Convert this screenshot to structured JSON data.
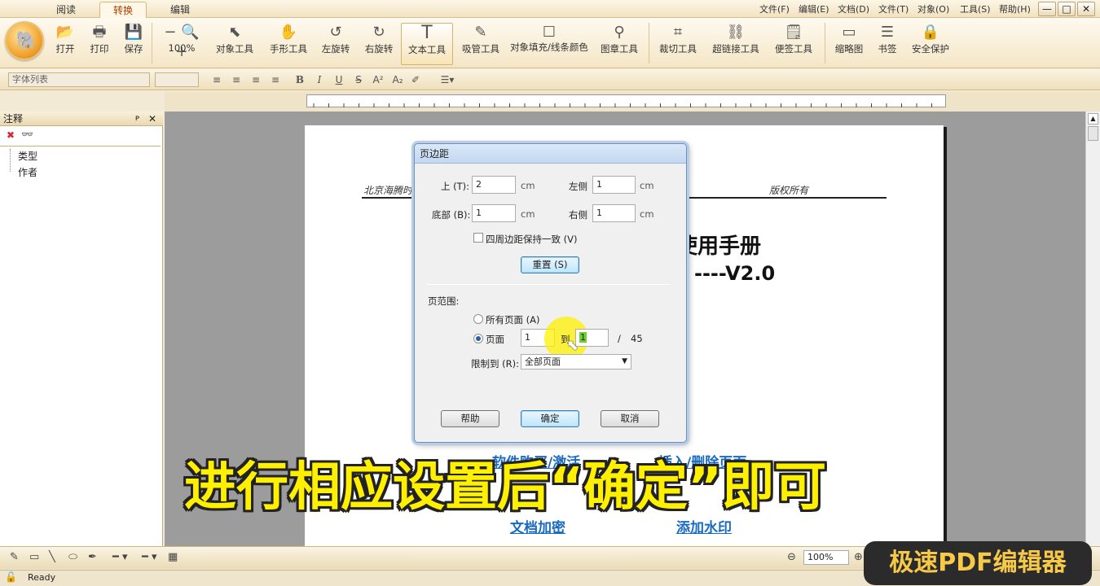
{
  "tabs": [
    "阅读",
    "转换",
    "编辑"
  ],
  "menu": [
    "文件(F)",
    "编辑(E)",
    "文档(D)",
    "文件(T)",
    "对象(O)",
    "工具(S)",
    "帮助(H)"
  ],
  "window_controls": [
    "—",
    "□",
    "✕"
  ],
  "ribbon": {
    "open": "打开",
    "print": "打印",
    "save": "保存",
    "zoom": "100%",
    "object_tool": "对象工具",
    "hand_tool": "手形工具",
    "rotate_left": "左旋转",
    "rotate_right": "右旋转",
    "text_tool": "文本工具",
    "eyedropper": "吸管工具",
    "fill_line_color": "对象填充/线条颜色",
    "stamp_tool": "图章工具",
    "crop_tool": "裁切工具",
    "link_tool": "超链接工具",
    "note_tool": "便签工具",
    "thumbnail": "缩略图",
    "bookmark": "书签",
    "security": "安全保护"
  },
  "format": {
    "font_list": "字体列表"
  },
  "left_panel": {
    "title": "注释",
    "pin": "ᴘ",
    "close": "✕",
    "tree": [
      "类型",
      "作者"
    ]
  },
  "document": {
    "header_left": "北京海腾时",
    "header_right": "版权所有",
    "title_line1": "使用手册",
    "title_line2": "----V2.0",
    "links": [
      "软件购买/激活",
      "插入/删除页面",
      "文档加密",
      "添加水印"
    ]
  },
  "dialog": {
    "title": "页边距",
    "top_label": "上 (T):",
    "top_value": "2",
    "unit": "cm",
    "left_label": "左侧",
    "left_value": "1",
    "bottom_label": "底部 (B):",
    "bottom_value": "1",
    "right_label": "右侧",
    "right_value": "1",
    "keep_uniform": "四周边距保持一致 (V)",
    "reset": "重置 (S)",
    "range_label": "页范围:",
    "all_pages": "所有页面 (A)",
    "pages": "页面",
    "from": "1",
    "to_label": "到",
    "to": "1",
    "slash": "/",
    "total": "45",
    "limit_label": "限制到 (R):",
    "limit_value": "全部页面",
    "help": "帮助",
    "ok": "确定",
    "cancel": "取消"
  },
  "caption": "进行相应设置后“确定”即可",
  "bottom": {
    "zoom": "100%"
  },
  "status": {
    "ready": "Ready"
  },
  "badge": "极速PDF编辑器"
}
